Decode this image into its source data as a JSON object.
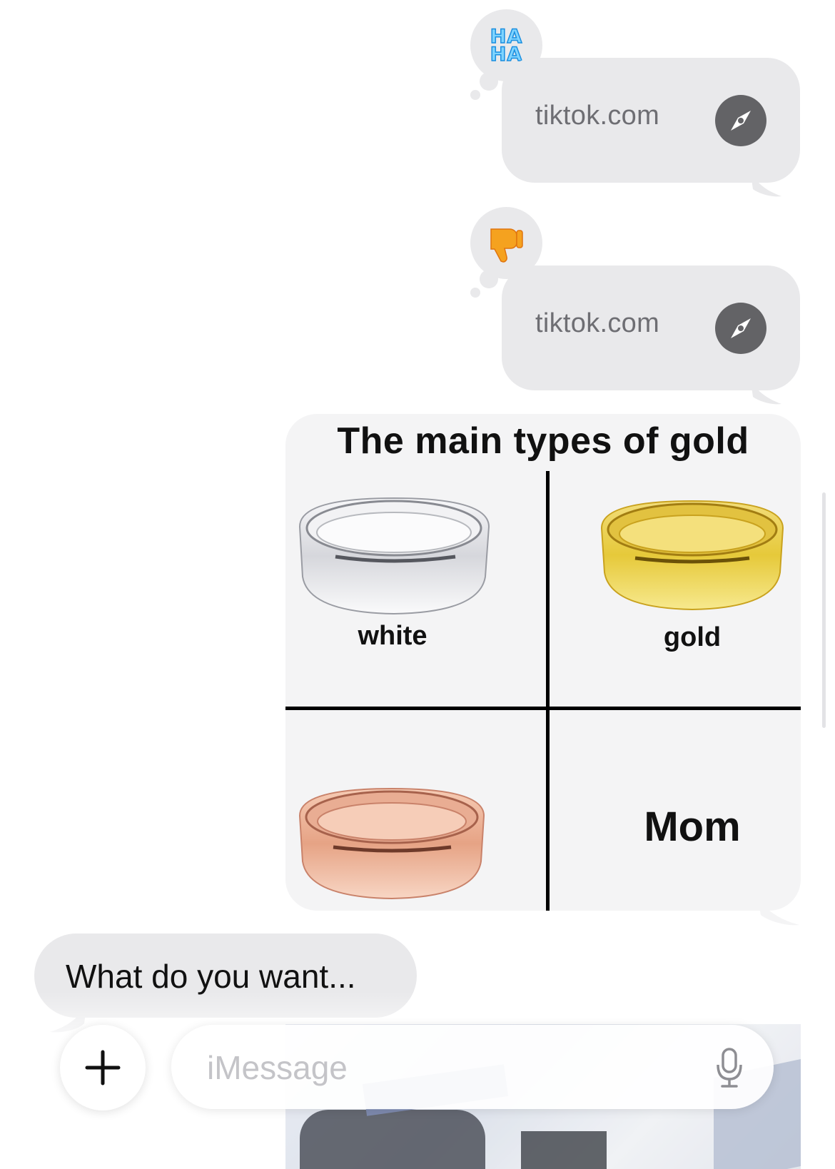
{
  "messages": [
    {
      "type": "link",
      "direction": "outgoing",
      "domain": "tiktok.com",
      "icon": "compass-icon",
      "reaction": {
        "type": "haha",
        "text_line1": "HA",
        "text_line2": "HA"
      }
    },
    {
      "type": "link",
      "direction": "outgoing",
      "domain": "tiktok.com",
      "icon": "compass-icon",
      "reaction": {
        "type": "thumbs-down",
        "emoji": "👎"
      }
    },
    {
      "type": "image",
      "direction": "outgoing",
      "image": {
        "title": "The main types of gold",
        "cells": [
          {
            "label": "white",
            "ring_color": "#dcdde2"
          },
          {
            "label": "gold",
            "ring_color": "#e8cd4a"
          },
          {
            "label": "",
            "ring_color": "#e8a889"
          },
          {
            "label": "Mom"
          }
        ]
      }
    },
    {
      "type": "text",
      "direction": "incoming",
      "text": "What do you want..."
    }
  ],
  "composer": {
    "placeholder": "iMessage",
    "plus_icon": "plus-icon",
    "mic_icon": "microphone-icon"
  },
  "colors": {
    "bubble_gray": "#e9e9eb",
    "link_text": "#6e6e73",
    "compass_bg": "#636366",
    "placeholder": "#c4c4c8"
  }
}
